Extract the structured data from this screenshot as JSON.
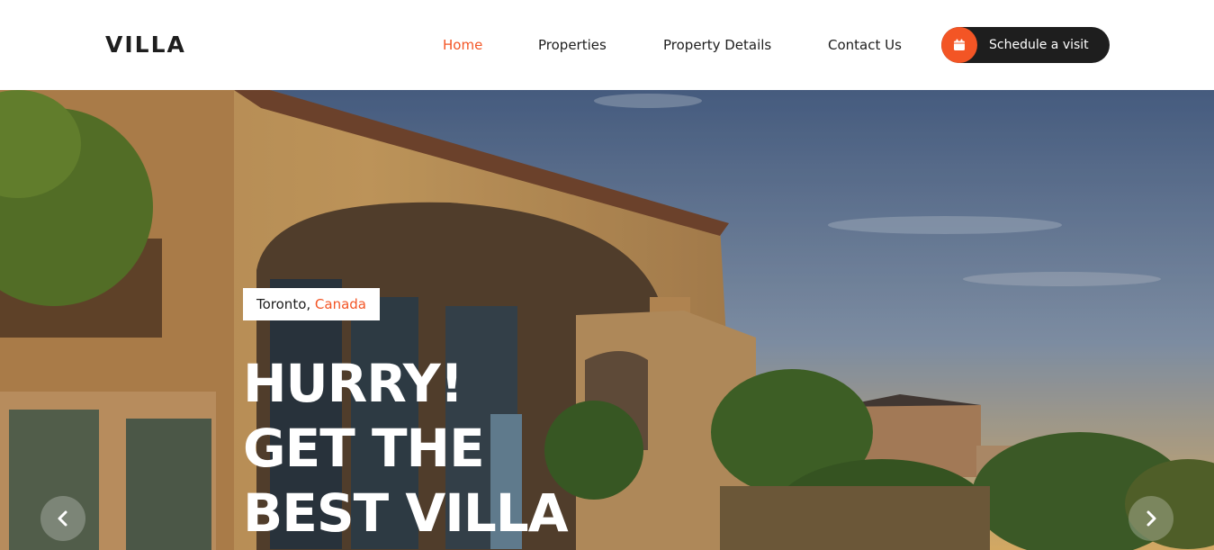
{
  "header": {
    "logo": "VILLA",
    "nav": {
      "home": "Home",
      "properties": "Properties",
      "property_details": "Property Details",
      "contact": "Contact Us"
    },
    "cta": {
      "label": "Schedule a visit",
      "icon": "calendar-icon"
    }
  },
  "hero": {
    "location": {
      "city": "Toronto,",
      "country": "Canada"
    },
    "title_lines": [
      "HURRY!",
      "GET THE",
      "BEST VILLA"
    ],
    "prev_icon": "chevron-left-icon",
    "next_icon": "chevron-right-icon"
  },
  "colors": {
    "accent": "#f35525",
    "dark": "#1e1e1e",
    "white": "#ffffff"
  }
}
